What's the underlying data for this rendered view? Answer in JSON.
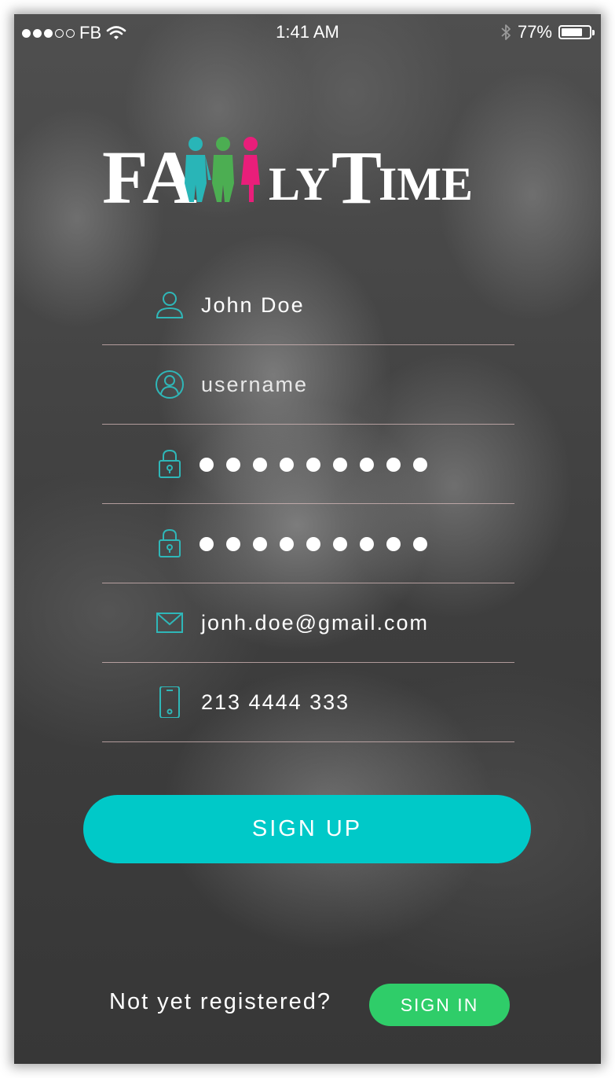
{
  "status_bar": {
    "carrier": "FB",
    "time": "1:41 AM",
    "battery_percent": "77%",
    "battery_level": 0.77,
    "signal_dots_filled": 3,
    "signal_dots_total": 5,
    "icons": [
      "wifi-icon",
      "bluetooth-icon",
      "battery-icon"
    ]
  },
  "logo": {
    "text": "FamilyTime",
    "prefix": "FA",
    "suffix_small_1": "LY",
    "suffix_big": "T",
    "suffix_small_2": "IME",
    "figure_colors": [
      "#29b5b7",
      "#4cae52",
      "#e91e7a"
    ]
  },
  "form": {
    "fields": [
      {
        "icon": "person-icon",
        "value": "John Doe",
        "type": "text"
      },
      {
        "icon": "account-circle-icon",
        "placeholder": "username",
        "type": "text"
      },
      {
        "icon": "lock-icon",
        "type": "password",
        "masked_length": 9
      },
      {
        "icon": "lock-icon",
        "type": "password",
        "masked_length": 9
      },
      {
        "icon": "envelope-icon",
        "value": "jonh.doe@gmail.com",
        "type": "email"
      },
      {
        "icon": "mobile-phone-icon",
        "value": "213 4444 333",
        "type": "tel"
      }
    ]
  },
  "actions": {
    "signup_label": "SIGN UP",
    "footer_prompt": "Not yet registered?",
    "signin_label": "SIGN IN"
  },
  "colors": {
    "accent_teal": "#00c9c8",
    "icon_teal": "#2fb7b8",
    "signin_green": "#2fcd69",
    "divider": "#d7b9b9"
  }
}
